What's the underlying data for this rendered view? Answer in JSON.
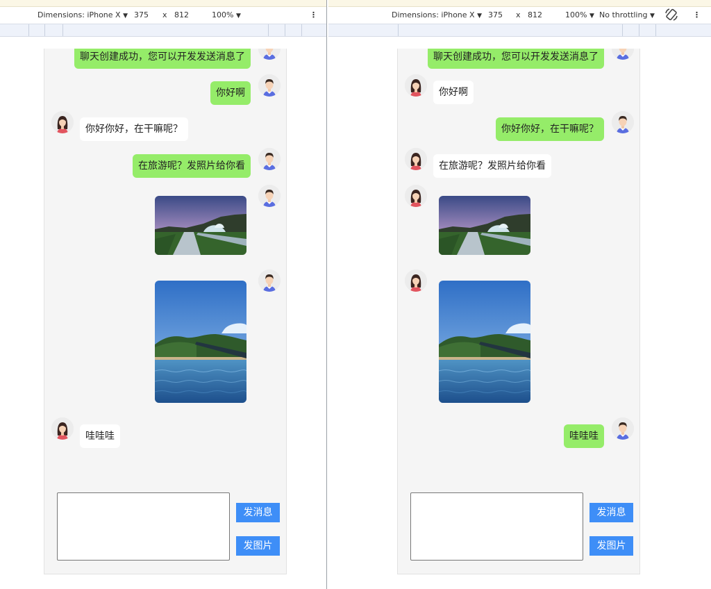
{
  "devtools": {
    "dimensions_label": "Dimensions: iPhone X",
    "width": "375",
    "times": "x",
    "height": "812",
    "zoom": "100%",
    "throttling": "No throttling"
  },
  "chat": {
    "msg_created": "聊天创建成功，您可以开发发送消息了",
    "msg_hello": "你好啊",
    "msg_reply": "你好你好，在干嘛呢？",
    "msg_travel": "在旅游呢？发照片给你看",
    "msg_wow": "哇哇哇"
  },
  "input": {
    "send_message": "发消息",
    "send_image": "发图片"
  },
  "colors": {
    "my_bubble": "#95ec69",
    "other_bubble": "#ffffff",
    "button": "#3e8ef7",
    "chat_bg": "#f5f5f5"
  },
  "icons": {
    "male_avatar": "male-avatar-icon",
    "female_avatar": "female-avatar-icon",
    "dropdown": "triangle-down-icon",
    "more": "vertical-dots-icon",
    "rotate": "rotate-icon"
  }
}
